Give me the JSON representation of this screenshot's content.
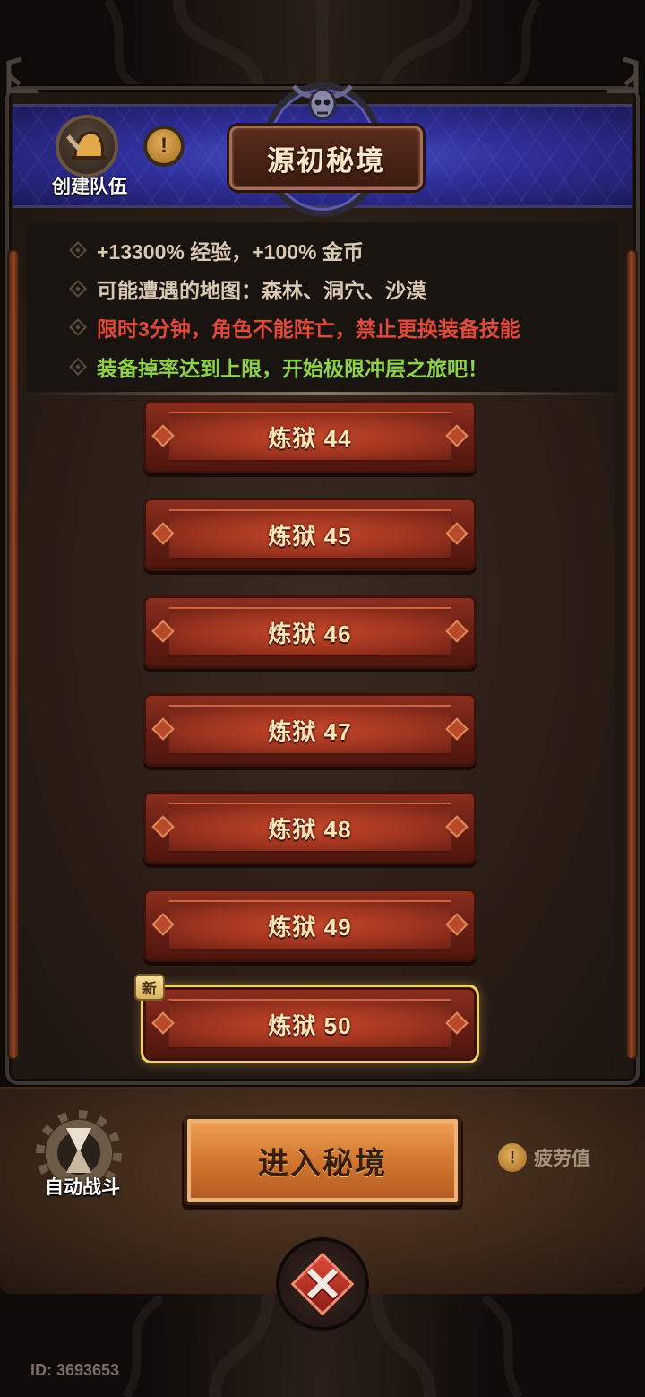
{
  "header": {
    "title": "源初秘境",
    "create_team_label": "创建队伍",
    "info_symbol": "!"
  },
  "info": {
    "line1": "+13300% 经验，+100% 金币",
    "line2": "可能遭遇的地图：森林、洞穴、沙漠",
    "line3": "限时3分钟，角色不能阵亡，禁止更换装备技能",
    "line4": "装备掉率达到上限，开始极限冲层之旅吧！"
  },
  "levels": [
    {
      "label": "炼狱 44"
    },
    {
      "label": "炼狱 45"
    },
    {
      "label": "炼狱 46"
    },
    {
      "label": "炼狱 47"
    },
    {
      "label": "炼狱 48"
    },
    {
      "label": "炼狱 49"
    },
    {
      "label": "炼狱 50",
      "badge": "新",
      "selected": true
    }
  ],
  "footer": {
    "auto_battle_label": "自动战斗",
    "enter_label": "进入秘境",
    "fatigue_label": "疲劳值",
    "fatigue_symbol": "!",
    "close_symbol": "✕"
  },
  "user_id": "ID: 3693653",
  "colors": {
    "warning_red": "#e04a3a",
    "highlight_green": "#8fd14a",
    "banner_blue": "#2f2f9a",
    "level_red": "#9e3420",
    "enter_orange": "#d67a32"
  }
}
